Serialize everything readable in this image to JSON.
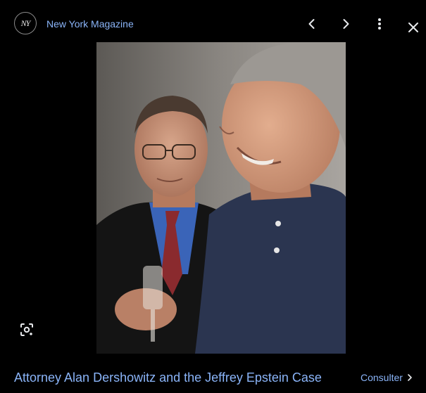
{
  "header": {
    "source_logo_text": "NY",
    "source_name": "New York Magazine",
    "prev_icon": "chevron-left-icon",
    "next_icon": "chevron-right-icon",
    "more_icon": "more-vert-icon",
    "close_icon": "close-icon"
  },
  "image": {
    "lens_icon": "lens-search-icon"
  },
  "footer": {
    "title": "Attorney Alan Dershowitz and the Jeffrey Epstein Case",
    "visit_label": "Consulter",
    "visit_icon": "chevron-right-icon"
  },
  "colors": {
    "background": "#000000",
    "link": "#8ab4f8",
    "icon": "#e8eaed"
  }
}
